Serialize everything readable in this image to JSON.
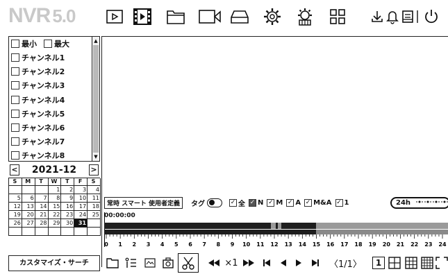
{
  "app": {
    "logo_main": "NVR",
    "logo_version": "5.0"
  },
  "toolbar": {
    "icons": [
      "live-view-icon",
      "playback-icon",
      "file-manager-icon",
      "backup-icon",
      "device-icon",
      "settings-icon",
      "advanced-settings-icon",
      "layout-icon",
      "download-icon",
      "alarm-icon",
      "log-icon",
      "power-icon"
    ],
    "active": "playback-icon"
  },
  "channels": {
    "min_label": "最小",
    "max_label": "最大",
    "items": [
      "チャンネル1",
      "チャンネル2",
      "チャンネル3",
      "チャンネル4",
      "チャンネル5",
      "チャンネル6",
      "チャンネル7",
      "チャンネル8"
    ]
  },
  "calendar": {
    "title": "2021-12",
    "prev": "<",
    "next": ">",
    "weekdays": [
      "S",
      "M",
      "T",
      "W",
      "T",
      "F",
      "S"
    ],
    "days": [
      "",
      "",
      "",
      "1",
      "2",
      "3",
      "4",
      "5",
      "6",
      "7",
      "8",
      "9",
      "10",
      "11",
      "12",
      "13",
      "14",
      "15",
      "16",
      "17",
      "18",
      "19",
      "20",
      "21",
      "22",
      "23",
      "24",
      "25",
      "26",
      "27",
      "28",
      "29",
      "30",
      "31",
      "",
      "",
      "",
      "",
      "",
      "",
      "",
      ""
    ],
    "selected_day": "31"
  },
  "search": {
    "custom_label": "カスタマイズ・サーチ"
  },
  "filters": {
    "record_type": "常時 スマート 使用者定義",
    "tag_label": "タグ",
    "checks": [
      {
        "label": "全",
        "filled": false
      },
      {
        "label": "N",
        "filled": true
      },
      {
        "label": "M",
        "filled": false
      },
      {
        "label": "A",
        "filled": false
      },
      {
        "label": "M&A",
        "filled": false
      },
      {
        "label": "1",
        "filled": false
      }
    ],
    "range_label": "24h"
  },
  "timeline": {
    "current_time": "00:00:00",
    "hours": [
      "0",
      "1",
      "2",
      "3",
      "4",
      "5",
      "6",
      "7",
      "8",
      "9",
      "10",
      "11",
      "12",
      "13",
      "14",
      "15",
      "16",
      "17",
      "18",
      "19",
      "20",
      "21",
      "22",
      "23",
      "24"
    ]
  },
  "playback": {
    "speed_label": "×1",
    "page_indicator": "〈1/1〉",
    "single_layout": "1"
  }
}
